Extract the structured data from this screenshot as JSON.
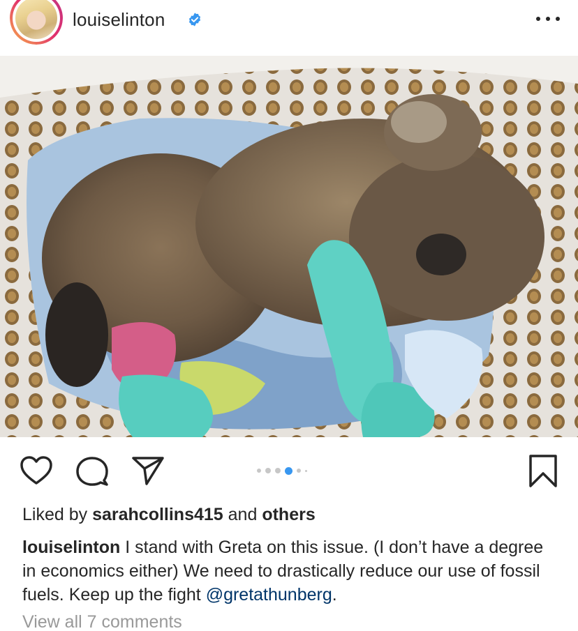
{
  "post": {
    "username": "louiselinton",
    "verified": true,
    "more_icon": "more-horizontal-icon",
    "image_alt": "koala",
    "carousel": {
      "count": 6,
      "active_index": 3
    },
    "likes": {
      "prefix": "Liked by",
      "user": "sarahcollins415",
      "middle": "and",
      "others": "others"
    },
    "caption": {
      "author": "louiselinton",
      "text": " I stand with Greta on this issue. (I don’t have a degree in economics either) We need to drastically reduce our use of fossil fuels. Keep up the fight ",
      "mention": "@gretathunberg",
      "suffix": "."
    },
    "view_comments": "View all 7 comments"
  },
  "icons": {
    "like": "heart-icon",
    "comment": "comment-icon",
    "share": "send-icon",
    "save": "bookmark-icon"
  },
  "colors": {
    "text": "#262626",
    "muted": "#999999",
    "link": "#003569",
    "carousel_active": "#3897f0",
    "verified": "#3897f0"
  }
}
